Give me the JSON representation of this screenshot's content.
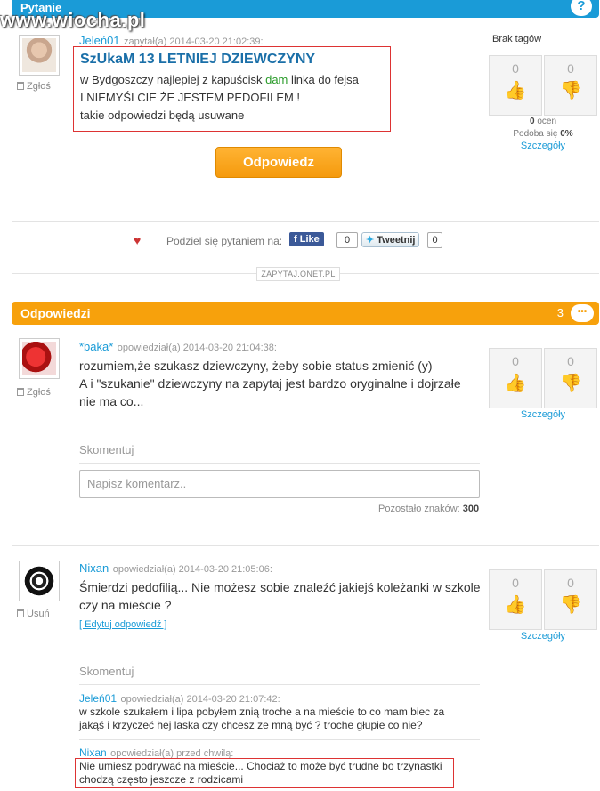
{
  "header": {
    "title": "Pytanie",
    "watermark": "www.wiocha.pl"
  },
  "question": {
    "author": "Jeleń01",
    "meta": "zapytał(a) 2014-03-20 21:02:39:",
    "report_label": "Zgłoś",
    "title": "SzUkaM 13 LETNIEJ DZIEWCZYNY",
    "line1_pre": "w Bydgoszczy najlepiej z kapuścisk ",
    "line1_link": "dam",
    "line1_post": " linka do fejsa",
    "line2": "I NIEMYŚLCIE ŻE JESTEM PEDOFILEM !",
    "line3": "takie odpowiedzi będą usuwane",
    "answer_button": "Odpowiedz",
    "tags": "Brak tagów",
    "votes_up": "0",
    "votes_down": "0",
    "ratings_count": "0",
    "ratings_label": "ocen",
    "likes_label": "Podoba się",
    "likes_pct": "0%",
    "details": "Szczegóły"
  },
  "share": {
    "text": "Podziel się pytaniem na:",
    "fb_label": "Like",
    "fb_count": "0",
    "tw_label": "Tweetnij",
    "tw_count": "0",
    "onet": "ZAPYTAJ.ONET.PL"
  },
  "answers_bar": {
    "title": "Odpowiedzi",
    "count": "3",
    "bubble": "•••"
  },
  "answers": [
    {
      "author": "*baka*",
      "meta": "opowiedział(a) 2014-03-20 21:04:38:",
      "report_label": "Zgłoś",
      "line1": "rozumiem,że szukasz dziewczyny, żeby sobie status zmienić (y)",
      "line2": "A i \"szukanie\" dziewczyny na zapytaj jest bardzo oryginalne i dojrzałe",
      "line3": "nie ma co...",
      "votes_up": "0",
      "votes_down": "0",
      "details": "Szczegóły",
      "comment_label": "Skomentuj",
      "comment_placeholder": "Napisz komentarz..",
      "remaining_label": "Pozostało znaków:",
      "remaining_value": "300"
    },
    {
      "author": "Nixan",
      "meta": "opowiedział(a) 2014-03-20 21:05:06:",
      "delete_label": "Usuń",
      "line1": "Śmierdzi pedofilią... Nie możesz sobie znaleźć jakiejś koleżanki w szkole",
      "line2": "czy na mieście ?",
      "edit_link": "[ Edytuj odpowiedź ]",
      "votes_up": "0",
      "votes_down": "0",
      "details": "Szczegóły",
      "comment_label": "Skomentuj",
      "comments": [
        {
          "author": "Jeleń01",
          "meta": "opowiedział(a) 2014-03-20 21:07:42:",
          "line1": "w szkole szukałem i lipa pobyłem znią troche a na mieście to co mam biec za",
          "line2": "jakąś i krzyczeć hej laska czy chcesz ze mną być ? troche głupie co nie?"
        },
        {
          "author": "Nixan",
          "meta": "opowiedział(a) przed chwilą:",
          "line1": "Nie umiesz podrywać na mieście... Chociaż to może być trudne bo trzynastki",
          "line2": "chodzą często jeszcze z rodzicami"
        }
      ]
    }
  ]
}
